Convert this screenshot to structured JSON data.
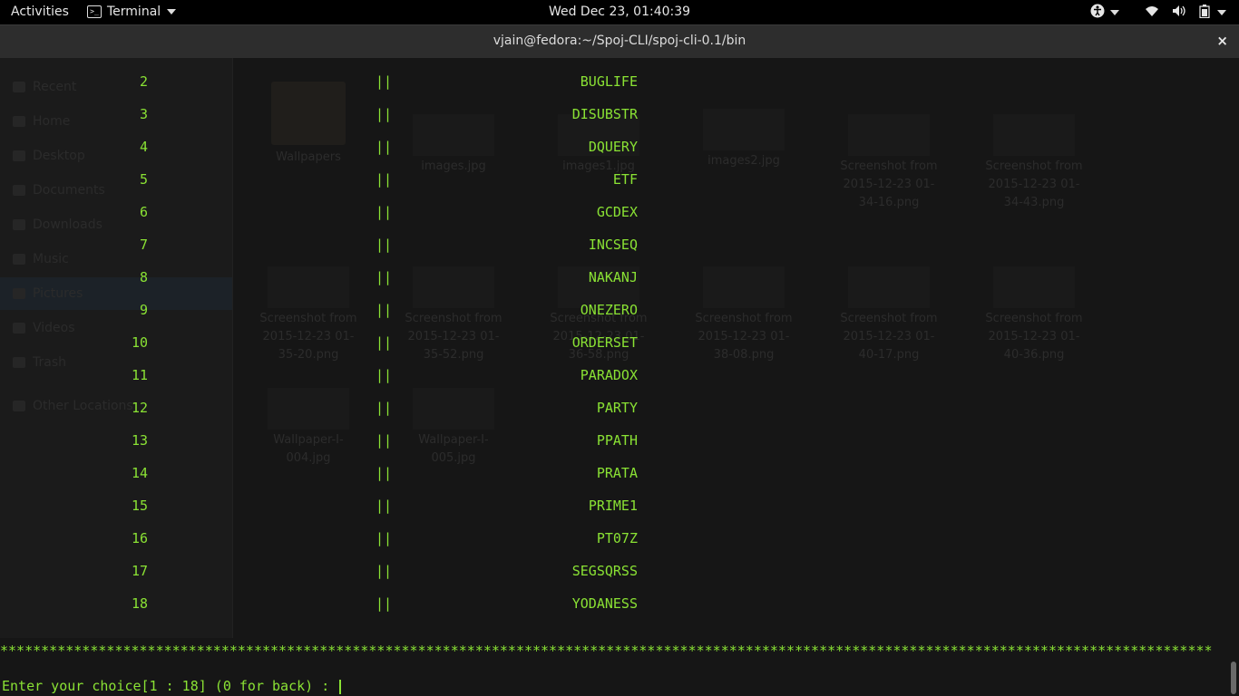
{
  "topbar": {
    "activities": "Activities",
    "app_menu": "Terminal",
    "clock": "Wed Dec 23, 01:40:39"
  },
  "window": {
    "title": "vjain@fedora:~/Spoj-CLI/spoj-cli-0.1/bin",
    "close": "×"
  },
  "ghost": {
    "sidebar": [
      "Recent",
      "Home",
      "Desktop",
      "Documents",
      "Downloads",
      "Music",
      "Pictures",
      "Videos",
      "Trash",
      "Other Locations"
    ],
    "files": [
      {
        "label": "Wallpapers"
      },
      {
        "label": "images.jpg"
      },
      {
        "label": "images1.jpg"
      },
      {
        "label": "images2.jpg"
      },
      {
        "label": "Screenshot from 2015-12-23 01-34-16.png"
      },
      {
        "label": "Screenshot from 2015-12-23 01-34-43.png"
      },
      {
        "label": "Screenshot from 2015-12-23 01-35-20.png"
      },
      {
        "label": "Screenshot from 2015-12-23 01-35-52.png"
      },
      {
        "label": "Screenshot from 2015-12-23 01-36-58.png"
      },
      {
        "label": "Screenshot from 2015-12-23 01-38-08.png"
      },
      {
        "label": "Screenshot from 2015-12-23 01-40-17.png"
      },
      {
        "label": "Screenshot from 2015-12-23 01-40-36.png"
      },
      {
        "label": "Wallpaper-I-004.jpg"
      },
      {
        "label": "Wallpaper-I-005.jpg"
      }
    ]
  },
  "terminal": {
    "separator": "||",
    "rows": [
      {
        "num": "2",
        "code": "BUGLIFE"
      },
      {
        "num": "3",
        "code": "DISUBSTR"
      },
      {
        "num": "4",
        "code": "DQUERY"
      },
      {
        "num": "5",
        "code": "ETF"
      },
      {
        "num": "6",
        "code": "GCDEX"
      },
      {
        "num": "7",
        "code": "INCSEQ"
      },
      {
        "num": "8",
        "code": "NAKANJ"
      },
      {
        "num": "9",
        "code": "ONEZERO"
      },
      {
        "num": "10",
        "code": "ORDERSET"
      },
      {
        "num": "11",
        "code": "PARADOX"
      },
      {
        "num": "12",
        "code": "PARTY"
      },
      {
        "num": "13",
        "code": "PPATH"
      },
      {
        "num": "14",
        "code": "PRATA"
      },
      {
        "num": "15",
        "code": "PRIME1"
      },
      {
        "num": "16",
        "code": "PT07Z"
      },
      {
        "num": "17",
        "code": "SEGSQRSS"
      },
      {
        "num": "18",
        "code": "YODANESS"
      }
    ],
    "stars": "****************************************************************************************************************************************************",
    "prompt": "Enter your choice[1 : 18] (0 for back) : "
  },
  "colors": {
    "terminal_fg": "#8ae234",
    "terminal_bg": "#161616",
    "titlebar_bg": "#2d2d2d",
    "topbar_bg": "#000000"
  },
  "icons": [
    "terminal-icon",
    "accessibility-icon",
    "wifi-icon",
    "volume-icon",
    "battery-icon",
    "close-icon"
  ]
}
